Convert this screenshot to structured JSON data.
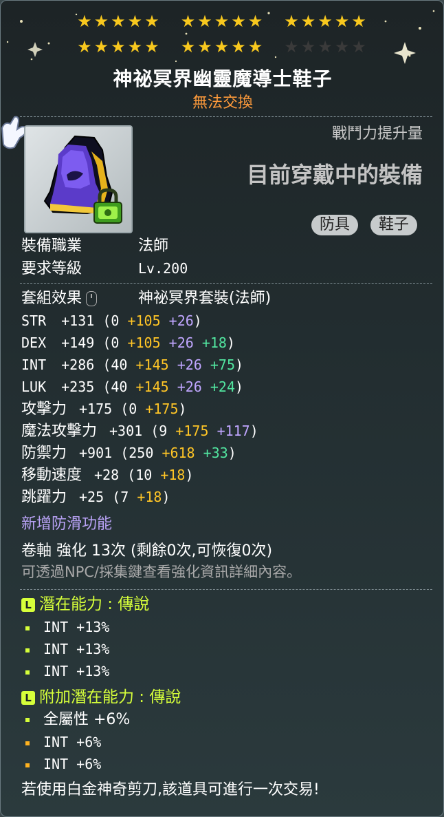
{
  "item": {
    "name": "神祕冥界幽靈魔導士鞋子",
    "trade_status": "無法交換",
    "star_rows": [
      {
        "groups": [
          5,
          5,
          5
        ],
        "lit": [
          5,
          5,
          5
        ]
      },
      {
        "groups": [
          5,
          5,
          5
        ],
        "lit": [
          5,
          5,
          0
        ]
      }
    ],
    "combat_power_label": "戰鬥力提升量",
    "equipped_text": "目前穿戴中的裝備",
    "tags": [
      "防具",
      "鞋子"
    ],
    "icon": "boots-icon",
    "lock_icon": "lock-icon"
  },
  "info": {
    "job_label": "裝備職業",
    "job_value": "法師",
    "level_label": "要求等級",
    "level_value": "Lv.200",
    "set_label": "套組效果",
    "set_value": "神祕冥界套裝(法師)"
  },
  "stats": [
    {
      "name": "STR",
      "total": "+131",
      "base": "0",
      "parts": [
        {
          "v": "+105",
          "c": "y"
        },
        {
          "v": "+26",
          "c": "p"
        }
      ]
    },
    {
      "name": "DEX",
      "total": "+149",
      "base": "0",
      "parts": [
        {
          "v": "+105",
          "c": "y"
        },
        {
          "v": "+26",
          "c": "p"
        },
        {
          "v": "+18",
          "c": "g"
        }
      ]
    },
    {
      "name": "INT",
      "total": "+286",
      "base": "40",
      "parts": [
        {
          "v": "+145",
          "c": "y"
        },
        {
          "v": "+26",
          "c": "p"
        },
        {
          "v": "+75",
          "c": "g"
        }
      ]
    },
    {
      "name": "LUK",
      "total": "+235",
      "base": "40",
      "parts": [
        {
          "v": "+145",
          "c": "y"
        },
        {
          "v": "+26",
          "c": "p"
        },
        {
          "v": "+24",
          "c": "g"
        }
      ]
    },
    {
      "name": "攻擊力",
      "total": "+175",
      "base": "0",
      "parts": [
        {
          "v": "+175",
          "c": "y"
        }
      ]
    },
    {
      "name": "魔法攻擊力",
      "total": "+301",
      "base": "9",
      "parts": [
        {
          "v": "+175",
          "c": "y"
        },
        {
          "v": "+117",
          "c": "p"
        }
      ]
    },
    {
      "name": "防禦力",
      "total": "+901",
      "base": "250",
      "parts": [
        {
          "v": "+618",
          "c": "y"
        },
        {
          "v": "+33",
          "c": "g"
        }
      ]
    },
    {
      "name": "移動速度",
      "total": "+28",
      "base": "10",
      "parts": [
        {
          "v": "+18",
          "c": "y"
        }
      ]
    },
    {
      "name": "跳躍力",
      "total": "+25",
      "base": "7",
      "parts": [
        {
          "v": "+18",
          "c": "y"
        }
      ]
    }
  ],
  "anti_slip": "新增防滑功能",
  "scroll": {
    "line": "卷軸 強化 13次 (剩餘0次,可恢復0次)",
    "hint": "可透過NPC/採集鍵查看強化資訊詳細內容。"
  },
  "potential": {
    "title": "潛在能力 : 傳說",
    "lines": [
      "INT +13%",
      "INT +13%",
      "INT +13%"
    ]
  },
  "bonus_potential": {
    "title": "附加潛在能力 : 傳說",
    "lines": [
      "全屬性 +6%",
      "INT +6%",
      "INT +6%"
    ]
  },
  "footer": "若使用白金神奇剪刀,該道具可進行一次交易!",
  "colors": {
    "star": "#f8c81e",
    "untradeable": "#ff9b3b",
    "scroll_bonus": "#ffc526",
    "flame_bonus": "#52e6a0",
    "star_bonus": "#c0a6ff",
    "potential": "#d6ff3a"
  }
}
